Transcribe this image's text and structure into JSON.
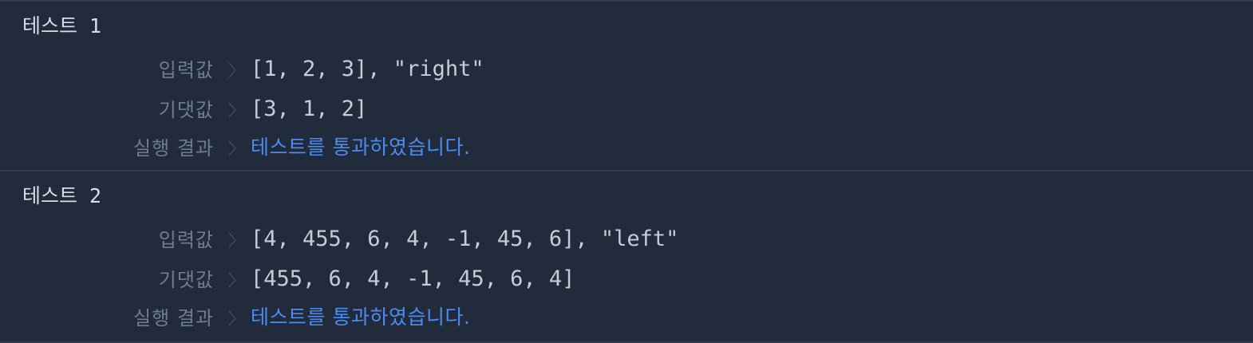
{
  "tests": [
    {
      "title": "테스트 1",
      "input_label": "입력값",
      "input_value": "[1, 2, 3], \"right\"",
      "expected_label": "기댓값",
      "expected_value": "[3, 1, 2]",
      "result_label": "실행 결과",
      "result_value": "테스트를 통과하였습니다."
    },
    {
      "title": "테스트 2",
      "input_label": "입력값",
      "input_value": "[4, 455, 6, 4, -1, 45, 6], \"left\"",
      "expected_label": "기댓값",
      "expected_value": "[455, 6, 4, -1, 45, 6, 4]",
      "result_label": "실행 결과",
      "result_value": "테스트를 통과하였습니다."
    }
  ],
  "colors": {
    "background": "#222b3b",
    "title": "#d8dee8",
    "label": "#6f7c90",
    "value": "#c4ccd8",
    "pass": "#4a8cf0"
  },
  "icons": {
    "separator": "chevron-right-icon"
  }
}
